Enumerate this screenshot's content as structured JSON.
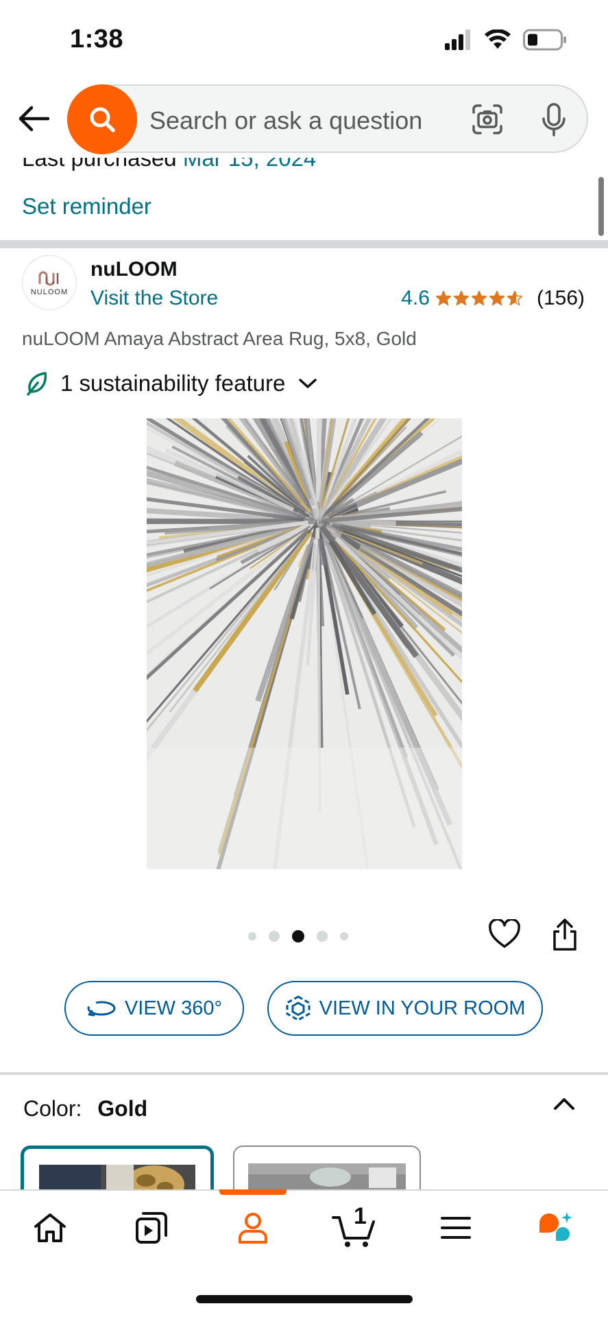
{
  "status_bar": {
    "time": "1:38"
  },
  "search": {
    "placeholder": "Search or ask a question"
  },
  "purchase": {
    "last_purchased_label": "Last purchased",
    "last_purchased_date": "Mar 15, 2024",
    "set_reminder": "Set reminder"
  },
  "product": {
    "brand_name": "nuLOOM",
    "brand_logo_text": "NULOOM",
    "visit_store": "Visit the Store",
    "rating": "4.6",
    "rating_stars": 4.6,
    "review_count": "(156)",
    "title": "nuLOOM Amaya Abstract Area Rug, 5x8, Gold",
    "sustainability": "1 sustainability feature",
    "image_count": 5,
    "active_image_index": 2
  },
  "view_buttons": {
    "view_360": "VIEW 360°",
    "view_in_room": "VIEW IN YOUR ROOM"
  },
  "color": {
    "label": "Color:",
    "value": "Gold"
  },
  "nav": {
    "cart_count": "1",
    "active": "account"
  },
  "colors": {
    "accent_orange": "#fe5f00",
    "link_teal": "#007185",
    "button_blue": "#00599a",
    "star_orange": "#de7921"
  },
  "icons": [
    "signal-icon",
    "wifi-icon",
    "battery-icon",
    "back-arrow-icon",
    "search-icon",
    "camera-icon",
    "mic-icon",
    "leaf-icon",
    "chevron-down-icon",
    "heart-icon",
    "share-icon",
    "rotate-360-icon",
    "cube-ar-icon",
    "chevron-up-icon",
    "home-icon",
    "video-icon",
    "account-icon",
    "cart-icon",
    "menu-icon",
    "rufus-icon"
  ]
}
